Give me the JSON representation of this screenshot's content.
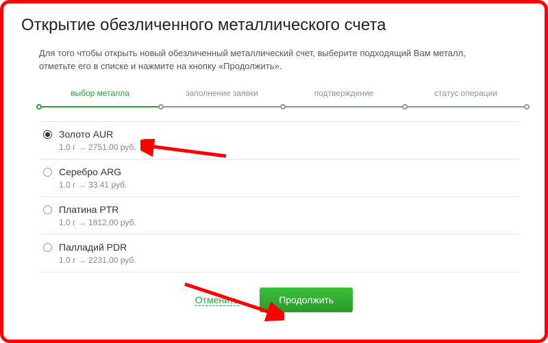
{
  "title": "Открытие обезличенного металлического счета",
  "instructions": "Для того чтобы открыть новый обезличенный металлический счет, выберите подходящий Вам металл, отметьте его в списке и нажмите на кнопку «Продолжить».",
  "steps": [
    {
      "label": "выбор металла",
      "active": true
    },
    {
      "label": "заполнение заявки",
      "active": false
    },
    {
      "label": "подтверждение",
      "active": false
    },
    {
      "label": "статус операции",
      "active": false
    }
  ],
  "metals": [
    {
      "name": "Золото AUR",
      "rate": "1.0 г → 2751.00 руб.",
      "selected": true
    },
    {
      "name": "Серебро ARG",
      "rate": "1.0 г → 33.41 руб.",
      "selected": false
    },
    {
      "name": "Платина PTR",
      "rate": "1.0 г → 1812.00 руб.",
      "selected": false
    },
    {
      "name": "Палладий PDR",
      "rate": "1.0 г → 2231.00 руб.",
      "selected": false
    }
  ],
  "actions": {
    "cancel": "Отменить",
    "continue": "Продолжить"
  }
}
